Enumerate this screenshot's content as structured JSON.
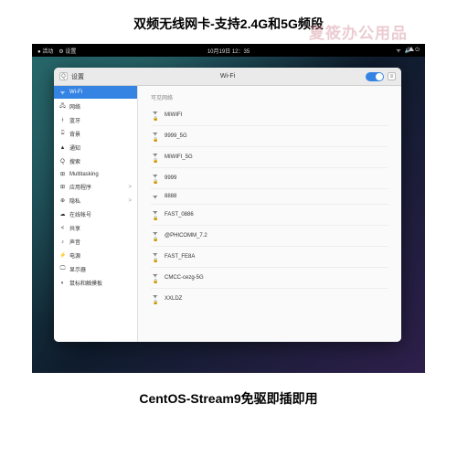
{
  "title_top": "双频无线网卡-支持2.4G和5G频段",
  "title_bottom": "CentOS-Stream9免驱即插即用",
  "watermark": "夏筱办公用品",
  "topbar": {
    "activities": "● 活动",
    "app": "⚙ 设置",
    "datetime": "10月19日 12：35"
  },
  "window": {
    "back_icon": "Q",
    "title_left": "设置",
    "title_center": "Wi-Fi",
    "menu_icon": "≡"
  },
  "sidebar": [
    {
      "icon": "ᯤ",
      "label": "Wi-Fi",
      "active": true
    },
    {
      "icon": "🖧",
      "label": "网络"
    },
    {
      "icon": "ᚼ",
      "label": "蓝牙"
    },
    {
      "icon": "⍓",
      "label": "背景"
    },
    {
      "icon": "▲",
      "label": "通知"
    },
    {
      "icon": "Q",
      "label": "搜索"
    },
    {
      "icon": "⊞",
      "label": "Multitasking"
    },
    {
      "icon": "⊞",
      "label": "应用程序",
      "chev": ">"
    },
    {
      "icon": "⊕",
      "label": "隐私",
      "chev": ">"
    },
    {
      "icon": "☁",
      "label": "在线帐号"
    },
    {
      "icon": "<",
      "label": "共享"
    },
    {
      "icon": "♪",
      "label": "声音"
    },
    {
      "icon": "⚡",
      "label": "电源"
    },
    {
      "icon": "🖵",
      "label": "显示器"
    },
    {
      "icon": "◐",
      "label": "鼠标和触摸板"
    }
  ],
  "content": {
    "section": "可见网络",
    "networks": [
      {
        "name": "MIWIFI",
        "locked": true
      },
      {
        "name": "9999_5G",
        "locked": true
      },
      {
        "name": "MIWIFI_5G",
        "locked": true
      },
      {
        "name": "9999",
        "locked": true
      },
      {
        "name": "8888",
        "locked": false
      },
      {
        "name": "FAST_0886",
        "locked": true
      },
      {
        "name": "@PHICOMM_7.2",
        "locked": true
      },
      {
        "name": "FAST_FE8A",
        "locked": true
      },
      {
        "name": "CMCC-cezg-5G",
        "locked": true
      },
      {
        "name": "XXLDZ",
        "locked": true
      }
    ]
  }
}
